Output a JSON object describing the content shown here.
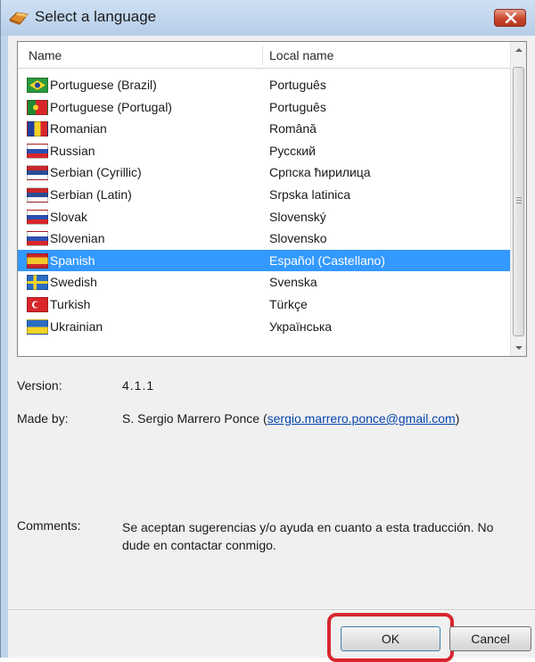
{
  "window": {
    "title": "Select a language"
  },
  "list": {
    "columns": {
      "name": "Name",
      "local": "Local name"
    },
    "selected_index": 8,
    "items": [
      {
        "name": "Portuguese (Brazil)",
        "local": "Português",
        "flag": "brazil-flag-icon"
      },
      {
        "name": "Portuguese (Portugal)",
        "local": "Português",
        "flag": "portugal-flag-icon"
      },
      {
        "name": "Romanian",
        "local": "Română",
        "flag": "romania-flag-icon"
      },
      {
        "name": "Russian",
        "local": "Русский",
        "flag": "russia-flag-icon"
      },
      {
        "name": "Serbian (Cyrillic)",
        "local": "Српска ћирилица",
        "flag": "serbia-flag-icon"
      },
      {
        "name": "Serbian (Latin)",
        "local": "Srpska latinica",
        "flag": "serbia-flag-icon"
      },
      {
        "name": "Slovak",
        "local": "Slovenský",
        "flag": "slovakia-flag-icon"
      },
      {
        "name": "Slovenian",
        "local": "Slovensko",
        "flag": "slovenia-flag-icon"
      },
      {
        "name": "Spanish",
        "local": "Español (Castellano)",
        "flag": "spain-flag-icon"
      },
      {
        "name": "Swedish",
        "local": "Svenska",
        "flag": "sweden-flag-icon"
      },
      {
        "name": "Turkish",
        "local": "Türkçe",
        "flag": "turkey-flag-icon"
      },
      {
        "name": "Ukrainian",
        "local": "Українська",
        "flag": "ukraine-flag-icon"
      }
    ]
  },
  "info": {
    "version_label": "Version:",
    "version_value": "4.1.1",
    "madeby_label": "Made by:",
    "madeby_name": "S. Sergio Marrero Ponce (",
    "madeby_email": "sergio.marrero.ponce@gmail.com",
    "madeby_close": ")",
    "comments_label": "Comments:",
    "comments_value": "Se aceptan sugerencias y/o ayuda en cuanto a esta traducción. No dude en contactar conmigo."
  },
  "buttons": {
    "ok": "OK",
    "cancel": "Cancel"
  },
  "colors": {
    "selection": "#3399ff",
    "highlight_ring": "#d7262e",
    "link": "#0645ad"
  }
}
